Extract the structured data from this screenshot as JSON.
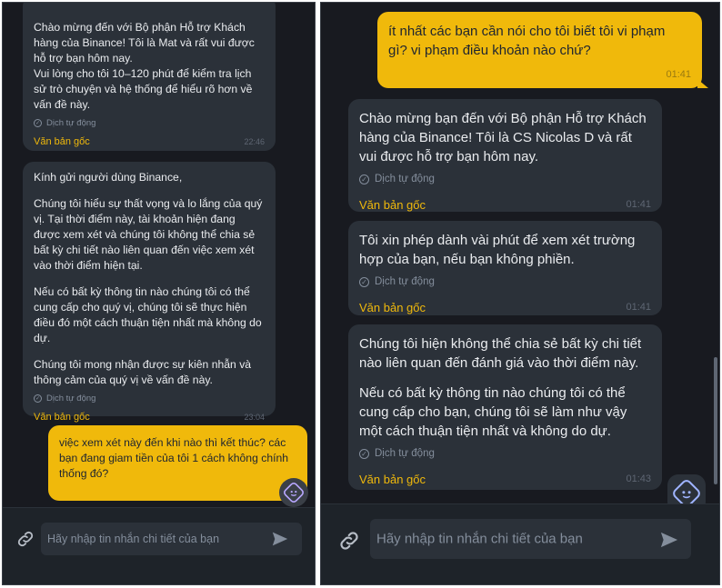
{
  "left": {
    "messages": [
      {
        "text": "Chào mừng đến với Bộ phận Hỗ trợ Khách hàng của Binance! Tôi là Mat và rất vui được hỗ trợ bạn hôm nay.\nVui lòng cho tôi 10–120 phút để kiểm tra lịch sử trò chuyện và hệ thống để hiểu rõ hơn về vấn đề này.",
        "auto": "Dịch tự động",
        "original": "Văn bản gốc",
        "time": "22:46"
      },
      {
        "p1": "Kính gửi người dùng Binance,",
        "p2": "Chúng tôi hiểu sự thất vọng và lo lắng của quý vị. Tại thời điểm này, tài khoản hiện đang được xem xét và chúng tôi không thể chia sẻ bất kỳ chi tiết nào liên quan đến việc xem xét vào thời điểm hiện tại.",
        "p3": "Nếu có bất kỳ thông tin nào chúng tôi có thể cung cấp cho quý vị, chúng tôi sẽ thực hiện điều đó một cách thuận tiện nhất mà không do dự.",
        "p4": "Chúng tôi mong nhận được sự kiên nhẫn và thông cảm của quý vị về vấn đề này.",
        "auto": "Dịch tự động",
        "original": "Văn bản gốc",
        "time": "23:04"
      },
      {
        "text": "việc xem xét này đến khi nào thì kết thúc? các bạn đang giam tiền của tôi 1 cách không chính thống đó?"
      }
    ],
    "input_placeholder": "Hãy nhập tin nhắn chi tiết của bạn"
  },
  "right": {
    "messages": [
      {
        "text": "ít nhất các bạn cần nói cho tôi biết tôi vi phạm gì? vi phạm điều khoản nào chứ?",
        "time": "01:41"
      },
      {
        "text": "Chào mừng bạn đến với Bộ phận Hỗ trợ Khách hàng của Binance! Tôi là CS Nicolas D và rất vui được hỗ trợ bạn hôm nay.",
        "auto": "Dịch tự động",
        "original": "Văn bản gốc",
        "time": "01:41"
      },
      {
        "text": "Tôi xin phép dành vài phút để xem xét trường hợp của bạn, nếu bạn không phiền.",
        "auto": "Dịch tự động",
        "original": "Văn bản gốc",
        "time": "01:41"
      },
      {
        "p1": "Chúng tôi hiện không thể chia sẻ bất kỳ chi tiết nào liên quan đến đánh giá vào thời điểm này.",
        "p2": "Nếu có bất kỳ thông tin nào chúng tôi có thể cung cấp cho bạn, chúng tôi sẽ làm như vậy một cách thuận tiện nhất và không do dự.",
        "auto": "Dịch tự động",
        "original": "Văn bản gốc",
        "time": "01:43"
      }
    ],
    "input_placeholder": "Hãy nhập tin nhắn chi tiết của bạn"
  },
  "icons": {
    "attach": "link-icon",
    "send": "send-arrow-icon",
    "assistant": "ai-assistant-icon",
    "check": "check-circle-icon"
  },
  "colors": {
    "background": "#181a20",
    "agent_bubble": "#2b3139",
    "user_bubble": "#f0b90b",
    "accent": "#f0b90b"
  }
}
